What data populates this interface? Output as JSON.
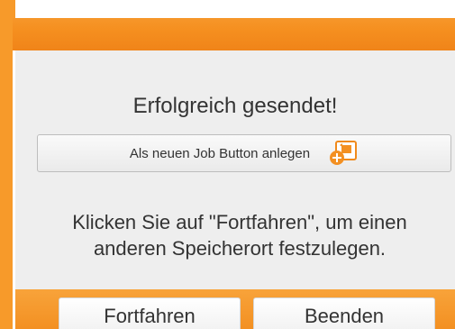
{
  "dialog": {
    "title": "Erfolgreich gesendet!",
    "job_button_label": "Als neuen Job Button anlegen",
    "job_button_icon": "add-job-button-icon",
    "message_line1": "Klicken Sie auf \"Fortfahren\", um einen",
    "message_line2": "anderen Speicherort festzulegen."
  },
  "footer": {
    "continue_label": "Fortfahren",
    "finish_label": "Beenden"
  },
  "colors": {
    "accent_orange": "#f39022",
    "dialog_background": "#eeeeee",
    "text": "#333333"
  }
}
